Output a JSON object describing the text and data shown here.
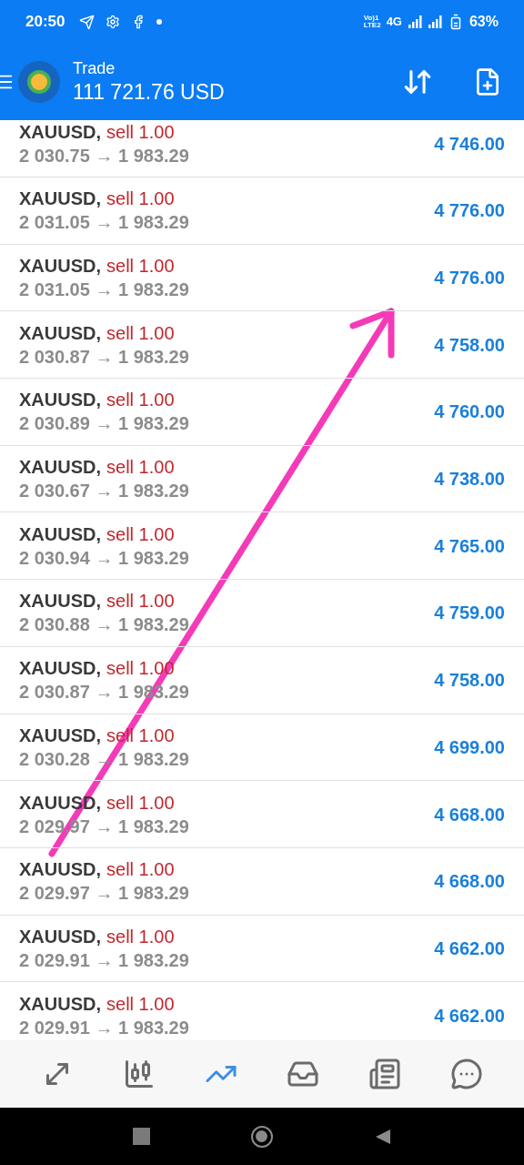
{
  "status_bar": {
    "time": "20:50",
    "volte_top": "Vo)1",
    "volte_bottom": "LTE2",
    "network": "4G",
    "battery": "63%"
  },
  "header": {
    "title": "Trade",
    "balance": "111 721.76 USD"
  },
  "positions": [
    {
      "symbol": "XAUUSD,",
      "order": "sell 1.00",
      "prices": "2 030.75 → 1 983.29",
      "profit": "4 746.00"
    },
    {
      "symbol": "XAUUSD,",
      "order": "sell 1.00",
      "prices": "2 031.05 → 1 983.29",
      "profit": "4 776.00"
    },
    {
      "symbol": "XAUUSD,",
      "order": "sell 1.00",
      "prices": "2 031.05 → 1 983.29",
      "profit": "4 776.00"
    },
    {
      "symbol": "XAUUSD,",
      "order": "sell 1.00",
      "prices": "2 030.87 → 1 983.29",
      "profit": "4 758.00"
    },
    {
      "symbol": "XAUUSD,",
      "order": "sell 1.00",
      "prices": "2 030.89 → 1 983.29",
      "profit": "4 760.00"
    },
    {
      "symbol": "XAUUSD,",
      "order": "sell 1.00",
      "prices": "2 030.67 → 1 983.29",
      "profit": "4 738.00"
    },
    {
      "symbol": "XAUUSD,",
      "order": "sell 1.00",
      "prices": "2 030.94 → 1 983.29",
      "profit": "4 765.00"
    },
    {
      "symbol": "XAUUSD,",
      "order": "sell 1.00",
      "prices": "2 030.88 → 1 983.29",
      "profit": "4 759.00"
    },
    {
      "symbol": "XAUUSD,",
      "order": "sell 1.00",
      "prices": "2 030.87 → 1 983.29",
      "profit": "4 758.00"
    },
    {
      "symbol": "XAUUSD,",
      "order": "sell 1.00",
      "prices": "2 030.28 → 1 983.29",
      "profit": "4 699.00"
    },
    {
      "symbol": "XAUUSD,",
      "order": "sell 1.00",
      "prices": "2 029.97 → 1 983.29",
      "profit": "4 668.00"
    },
    {
      "symbol": "XAUUSD,",
      "order": "sell 1.00",
      "prices": "2 029.97 → 1 983.29",
      "profit": "4 668.00"
    },
    {
      "symbol": "XAUUSD,",
      "order": "sell 1.00",
      "prices": "2 029.91 → 1 983.29",
      "profit": "4 662.00"
    },
    {
      "symbol": "XAUUSD,",
      "order": "sell 1.00",
      "prices": "2 029.91 → 1 983.29",
      "profit": "4 662.00"
    }
  ],
  "bottom_nav": [
    {
      "kind": "quotes",
      "selected": false
    },
    {
      "kind": "chart",
      "selected": false
    },
    {
      "kind": "trade",
      "selected": true
    },
    {
      "kind": "history",
      "selected": false
    },
    {
      "kind": "news",
      "selected": false
    },
    {
      "kind": "chat",
      "selected": false
    }
  ]
}
